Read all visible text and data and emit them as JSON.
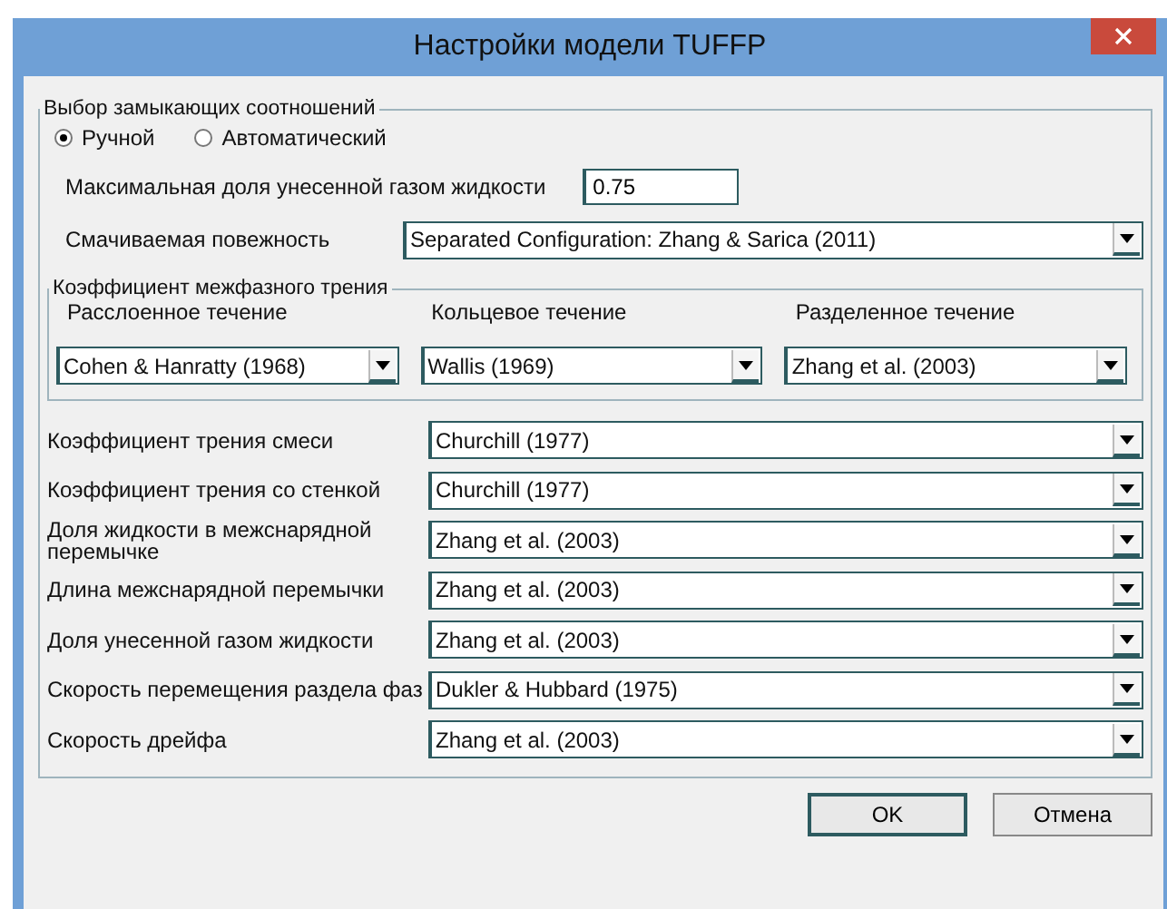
{
  "window": {
    "title": "Настройки модели TUFFP"
  },
  "closure_group": {
    "legend": "Выбор замыкающих соотношений",
    "modes": [
      {
        "label": "Ручной",
        "selected": true
      },
      {
        "label": "Автоматический",
        "selected": false
      }
    ],
    "max_entrained": {
      "label": "Максимальная доля унесенной газом жидкости",
      "value": "0.75"
    },
    "wetted_surface": {
      "label": "Смачиваемая повежность",
      "value": "Separated Configuration: Zhang & Sarica (2011)"
    },
    "interfacial_group": {
      "legend": "Коэффициент межфазного трения",
      "columns": [
        {
          "label": "Расслоенное течение",
          "value": "Cohen & Hanratty (1968)"
        },
        {
          "label": "Кольцевое течение",
          "value": "Wallis (1969)"
        },
        {
          "label": "Разделенное течение",
          "value": "Zhang et al. (2003)"
        }
      ]
    },
    "rows": [
      {
        "label": "Коэффициент трения смеси",
        "value": "Churchill (1977)"
      },
      {
        "label": "Коэффициент трения со стенкой",
        "value": "Churchill (1977)"
      },
      {
        "label": "Доля жидкости в межснарядной перемычке",
        "value": "Zhang et al. (2003)"
      },
      {
        "label": "Длина межснарядной перемычки",
        "value": "Zhang et al. (2003)"
      },
      {
        "label": "Доля унесенной газом жидкости",
        "value": "Zhang et al. (2003)"
      },
      {
        "label": "Скорость перемещения раздела фаз",
        "value": "Dukler & Hubbard (1975)"
      },
      {
        "label": "Скорость дрейфа",
        "value": "Zhang et al. (2003)"
      }
    ]
  },
  "buttons": [
    {
      "label": "OK",
      "default": true
    },
    {
      "label": "Отмена",
      "default": false
    }
  ]
}
